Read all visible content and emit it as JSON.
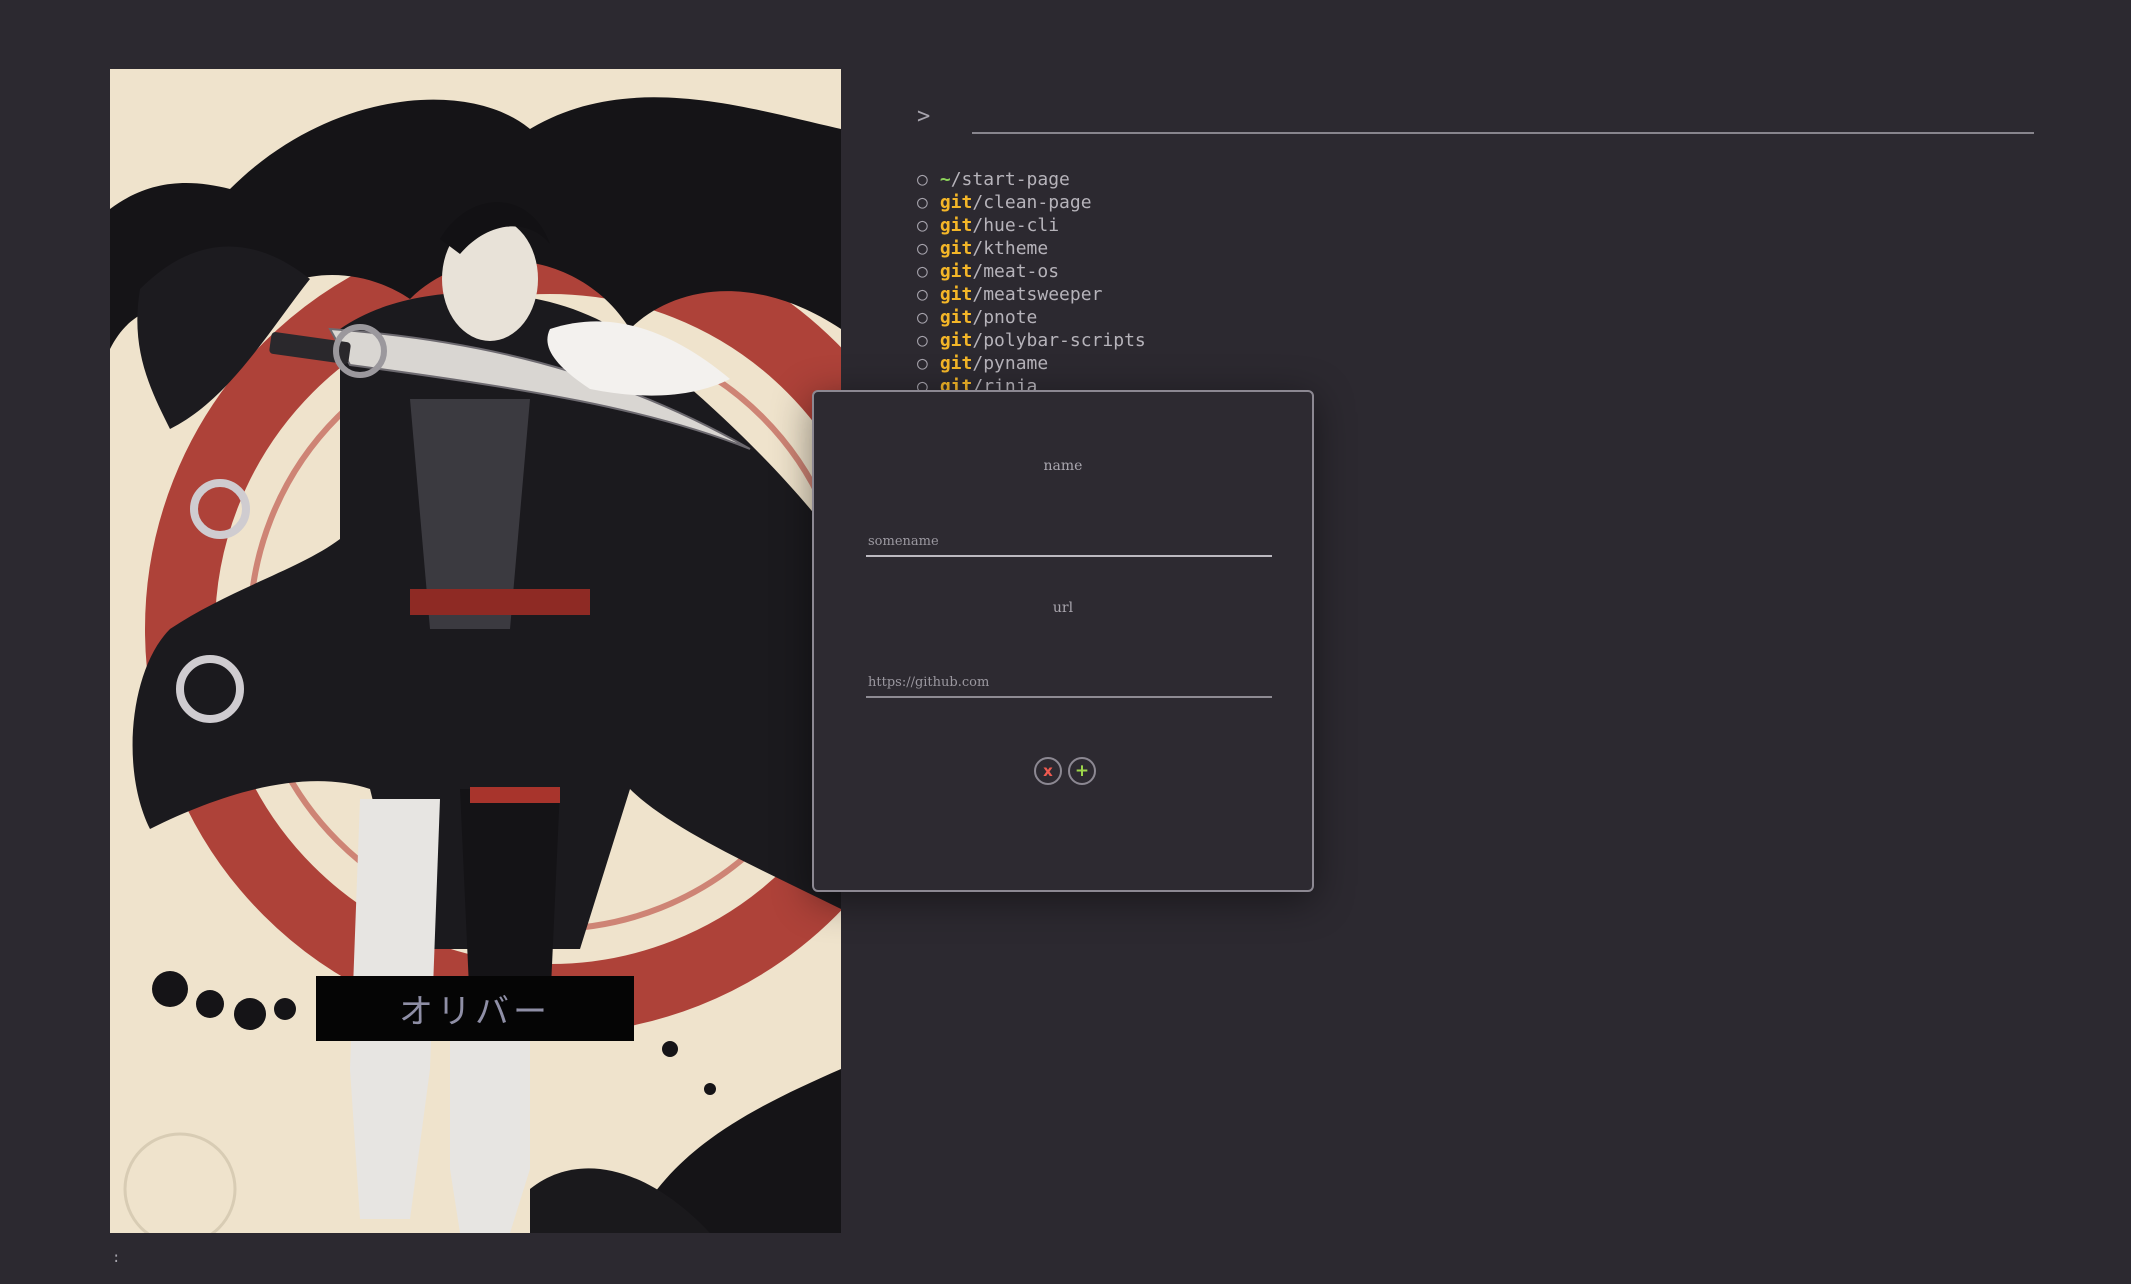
{
  "prompt": {
    "symbol": ">"
  },
  "links": [
    {
      "bullet": "○",
      "prefix": "~",
      "path": "/start-page",
      "prefix_style": "tilde"
    },
    {
      "bullet": "○",
      "prefix": "git",
      "path": "/clean-page",
      "prefix_style": "git"
    },
    {
      "bullet": "○",
      "prefix": "git",
      "path": "/hue-cli",
      "prefix_style": "git"
    },
    {
      "bullet": "○",
      "prefix": "git",
      "path": "/ktheme",
      "prefix_style": "git"
    },
    {
      "bullet": "○",
      "prefix": "git",
      "path": "/meat-os",
      "prefix_style": "git"
    },
    {
      "bullet": "○",
      "prefix": "git",
      "path": "/meatsweeper",
      "prefix_style": "git"
    },
    {
      "bullet": "○",
      "prefix": "git",
      "path": "/pnote",
      "prefix_style": "git"
    },
    {
      "bullet": "○",
      "prefix": "git",
      "path": "/polybar-scripts",
      "prefix_style": "git"
    },
    {
      "bullet": "○",
      "prefix": "git",
      "path": "/pyname",
      "prefix_style": "git"
    },
    {
      "bullet": "○",
      "prefix": "git",
      "path": "/rinja",
      "prefix_style": "git"
    }
  ],
  "art": {
    "nameplate": "オリバー"
  },
  "modal": {
    "name_label": "name",
    "name_placeholder": "somename",
    "url_label": "url",
    "url_placeholder": "https://github.com",
    "cancel_label": "x",
    "add_label": "+"
  },
  "status": {
    "text": ":"
  },
  "colors": {
    "background": "#2c2930",
    "git_prefix": "#f4b628",
    "home_prefix": "#8bd05a",
    "cancel": "#f05a50",
    "add": "#9ed84a",
    "accent_red": "#b3332c"
  }
}
